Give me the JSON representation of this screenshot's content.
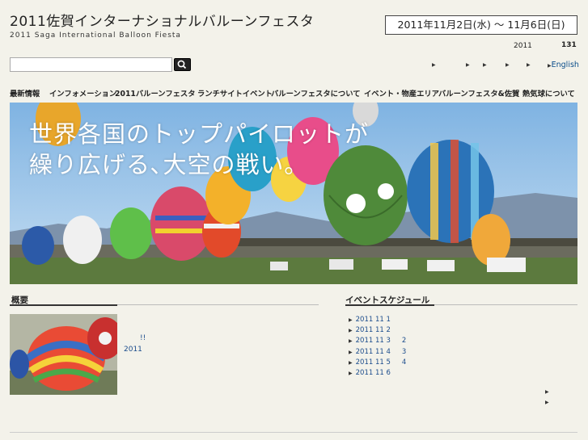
{
  "header": {
    "title": "2011佐賀インターナショナルバルーンフェスタ",
    "subtitle": "2011 Saga International Balloon Fiesta",
    "dates": "2011年11月2日(水) ～ 11月6日(日)",
    "year": "2011",
    "count": "131"
  },
  "search": {
    "value": "",
    "placeholder": ""
  },
  "utility": {
    "english": "English"
  },
  "nav": {
    "items": [
      "最新情報",
      "インフォメーション",
      "2011バルーンフェスタ",
      "ランチサイトイベント",
      "バルーンフェスタについて",
      "イベント・物産エリア",
      "バルーンフェスタ&佐賀",
      "熱気球について"
    ]
  },
  "hero": {
    "line1": "世界各国のトップパイロットが",
    "line2": "繰り広げる､大空の戦い｡"
  },
  "overview": {
    "title": "概要",
    "exclaim": "!!",
    "year": "2011"
  },
  "schedule": {
    "title": "イベントスケジュール",
    "items": [
      {
        "date": "2011 11 1",
        "extra": ""
      },
      {
        "date": "2011 11 2",
        "extra": ""
      },
      {
        "date": "2011 11 3",
        "extra": "2"
      },
      {
        "date": "2011 11 4",
        "extra": "3"
      },
      {
        "date": "2011 11 5",
        "extra": "4"
      },
      {
        "date": "2011 11 6",
        "extra": ""
      }
    ]
  },
  "colors": {
    "background": "#f3f2ea",
    "link": "#1b4c8c",
    "sky": "#8fc0e8"
  }
}
